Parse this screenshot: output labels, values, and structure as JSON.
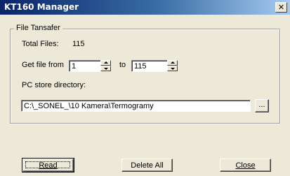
{
  "window": {
    "title": "KT160 Manager",
    "close_glyph": "✕"
  },
  "group": {
    "title": "File Tansafer"
  },
  "total_files": {
    "label": "Total Files:",
    "value": "115"
  },
  "get_file": {
    "label": "Get file from",
    "from_value": "1",
    "to_label": "to",
    "to_value": "115"
  },
  "pc_store": {
    "label": "PC store directory:",
    "path": "C:\\_SONEL_\\10 Kamera\\Termogramy",
    "browse_label": "..."
  },
  "buttons": {
    "read": "Read",
    "delete_all": "Delete All",
    "close": "Close"
  }
}
